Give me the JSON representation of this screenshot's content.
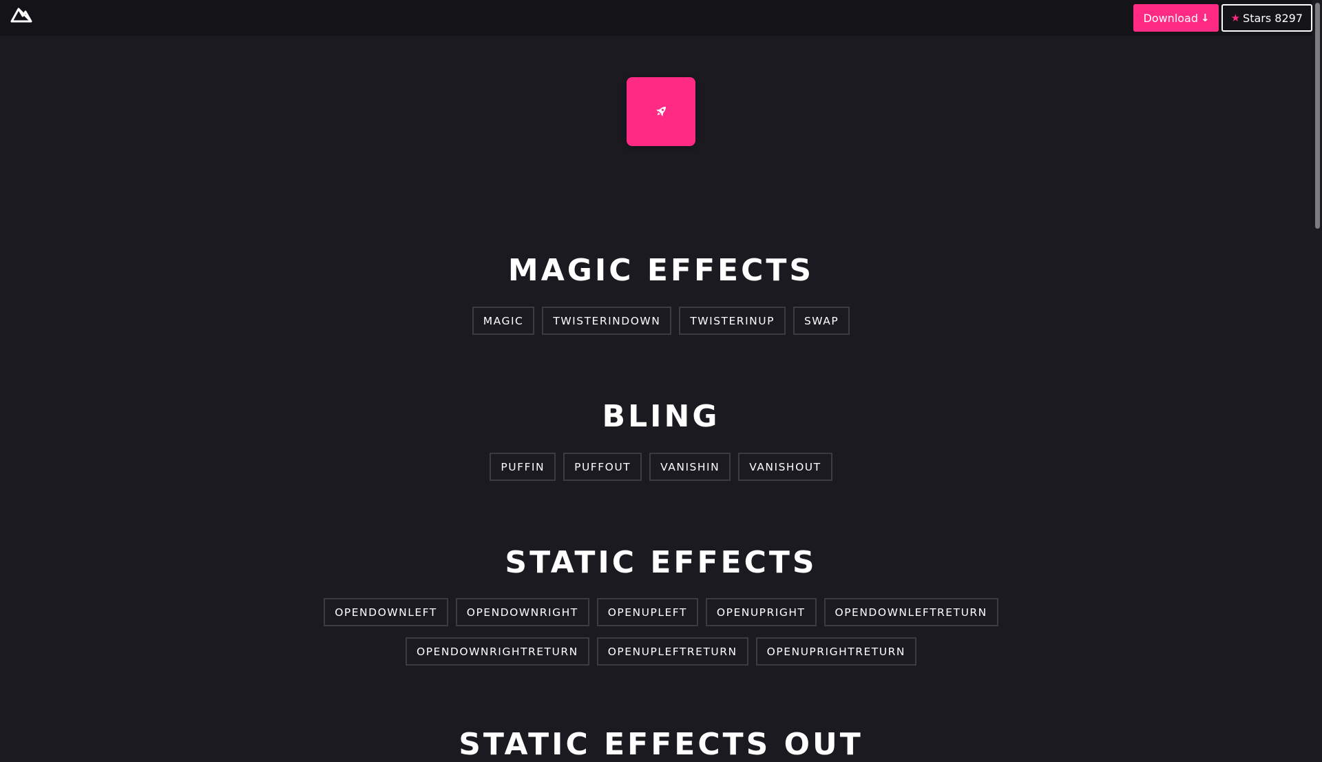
{
  "header": {
    "logo_icon": "triangle-logo-icon",
    "download_label": "Download",
    "download_icon": "arrow-down-icon",
    "stars_icon": "star-icon",
    "stars_label": "Stars 8297"
  },
  "hero": {
    "icon": "rocket-icon",
    "accent_color": "#ff2a83"
  },
  "sections": [
    {
      "title": "MAGIC EFFECTS",
      "rows": [
        [
          "MAGIC",
          "TWISTERINDOWN",
          "TWISTERINUP",
          "SWAP"
        ]
      ]
    },
    {
      "title": "BLING",
      "rows": [
        [
          "PUFFIN",
          "PUFFOUT",
          "VANISHIN",
          "VANISHOUT"
        ]
      ]
    },
    {
      "title": "STATIC EFFECTS",
      "rows": [
        [
          "OPENDOWNLEFT",
          "OPENDOWNRIGHT",
          "OPENUPLEFT",
          "OPENUPRIGHT",
          "OPENDOWNLEFTRETURN"
        ],
        [
          "OPENDOWNRIGHTRETURN",
          "OPENUPLEFTRETURN",
          "OPENUPRIGHTRETURN"
        ]
      ]
    },
    {
      "title": "STATIC EFFECTS OUT",
      "rows": []
    }
  ],
  "colors": {
    "background": "#1b1a21",
    "topbar": "#141318",
    "button_border": "#3c3b43",
    "accent": "#ff2a83"
  }
}
